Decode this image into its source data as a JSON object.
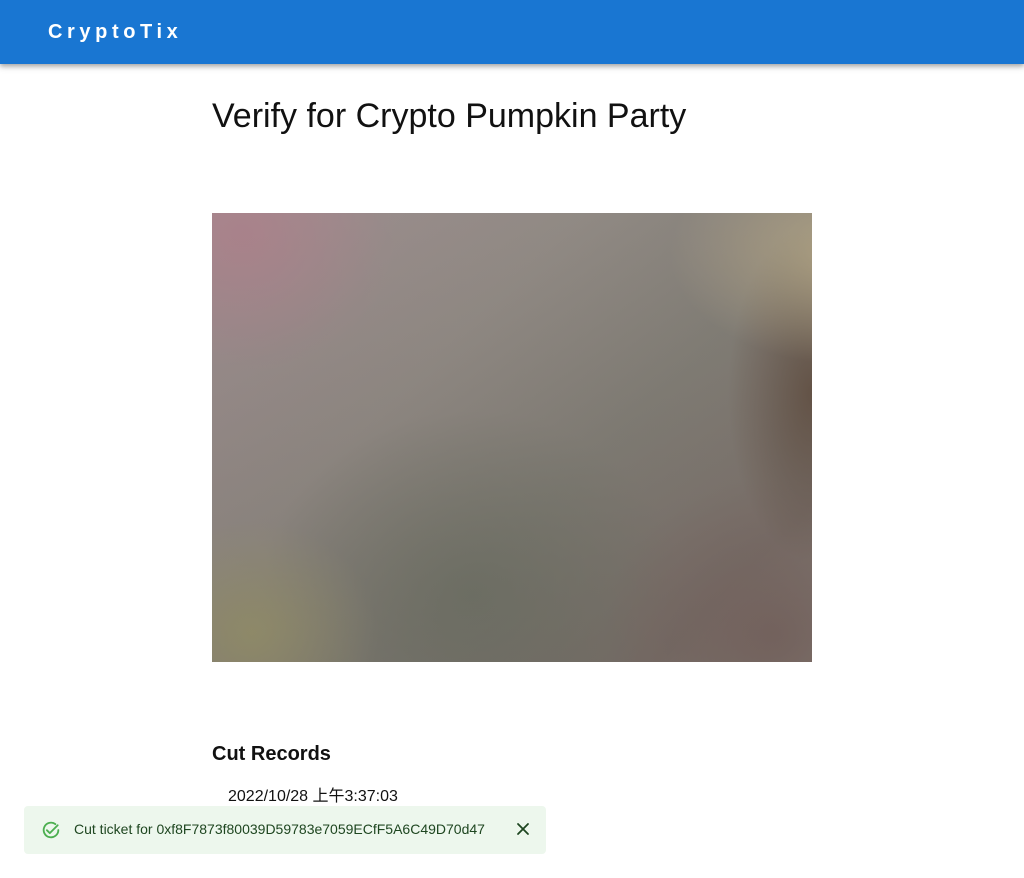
{
  "app": {
    "brand": "CryptoTix",
    "brand_color": "#1976d2"
  },
  "page": {
    "title": "Verify for Crypto Pumpkin Party"
  },
  "scanner": {
    "icon": "camera-feed"
  },
  "records": {
    "heading": "Cut Records",
    "items": [
      {
        "timestamp": "2022/10/28 上午3:37:03"
      }
    ]
  },
  "snackbar": {
    "severity": "success",
    "icon": "check-circle-icon",
    "message": "Cut ticket for 0xf8F7873f80039D59783e7059ECfF5A6C49D70d47",
    "close_icon": "close-icon",
    "background": "#edf7ed",
    "icon_color": "#4caf50"
  }
}
